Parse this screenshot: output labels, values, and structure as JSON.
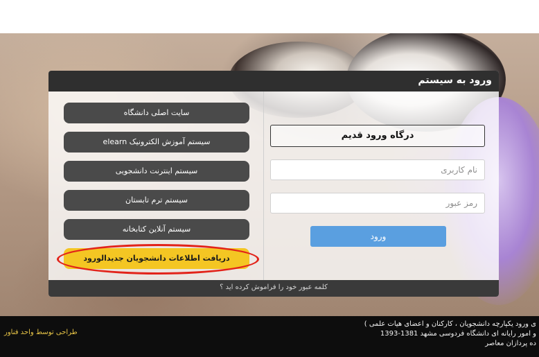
{
  "login": {
    "title": "ورود به سیستم",
    "old_portal_label": "درگاه ورود قدیم",
    "username_placeholder": "نام کاربری",
    "password_placeholder": "رمز عبور",
    "submit_label": "ورود",
    "forgot_label": "کلمه عبور خود را فراموش کرده اید ؟"
  },
  "links": [
    {
      "label": "سایت اصلی دانشگاه"
    },
    {
      "label": "سیستم آموزش الکترونیک elearn"
    },
    {
      "label": "سیستم اینترنت دانشجویی"
    },
    {
      "label": "سیستم ترم تابستان"
    },
    {
      "label": "سیستم آنلاین کتابخانه"
    },
    {
      "label": "دریافت اطلاعات دانشجویان جدیدالورود"
    }
  ],
  "footer": {
    "credit": "طراحی توسط واحد فناور",
    "line1": "ی ورود یکپارچه دانشجویان ، کارکنان و اعضای هیات علمی )",
    "line2": "و امور رایانه ای دانشگاه فردوسی مشهد 1381-1393",
    "line3": "ده پردازان معاصر"
  },
  "colors": {
    "highlight_button": "#f4c623",
    "highlight_ring": "#e2231a",
    "submit_button": "#5a9fe0"
  }
}
